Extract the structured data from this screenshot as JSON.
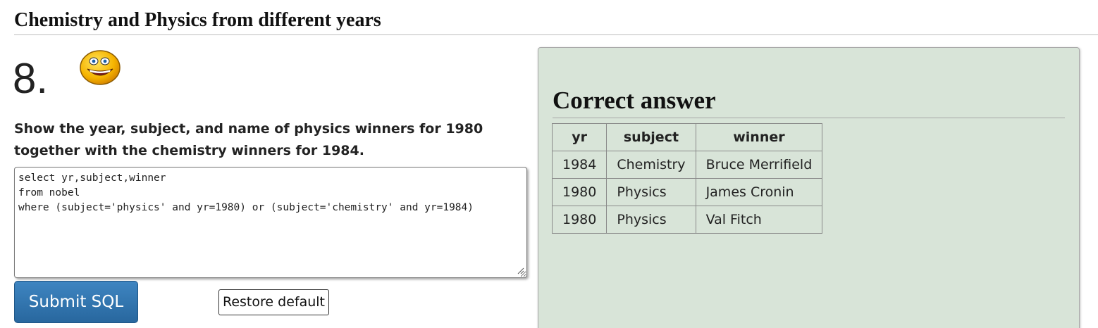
{
  "section_title": "Chemistry and Physics from different years",
  "question": {
    "number": "8.",
    "text": "Show the year, subject, and name of physics winners for 1980 together with the chemistry winners for 1984.",
    "icon": "smiley-face-icon"
  },
  "editor": {
    "sql": "select yr,subject,winner\nfrom nobel\nwhere (subject='physics' and yr=1980) or (subject='chemistry' and yr=1984)"
  },
  "buttons": {
    "submit_label": "Submit SQL",
    "restore_label": "Restore default"
  },
  "answer": {
    "heading": "Correct answer",
    "columns": [
      "yr",
      "subject",
      "winner"
    ],
    "rows": [
      [
        "1984",
        "Chemistry",
        "Bruce Merrifield"
      ],
      [
        "1980",
        "Physics",
        "James Cronin"
      ],
      [
        "1980",
        "Physics",
        "Val Fitch"
      ]
    ]
  },
  "colors": {
    "submit_button": "#2f72ad",
    "answer_panel_bg": "#d8e4d8"
  }
}
